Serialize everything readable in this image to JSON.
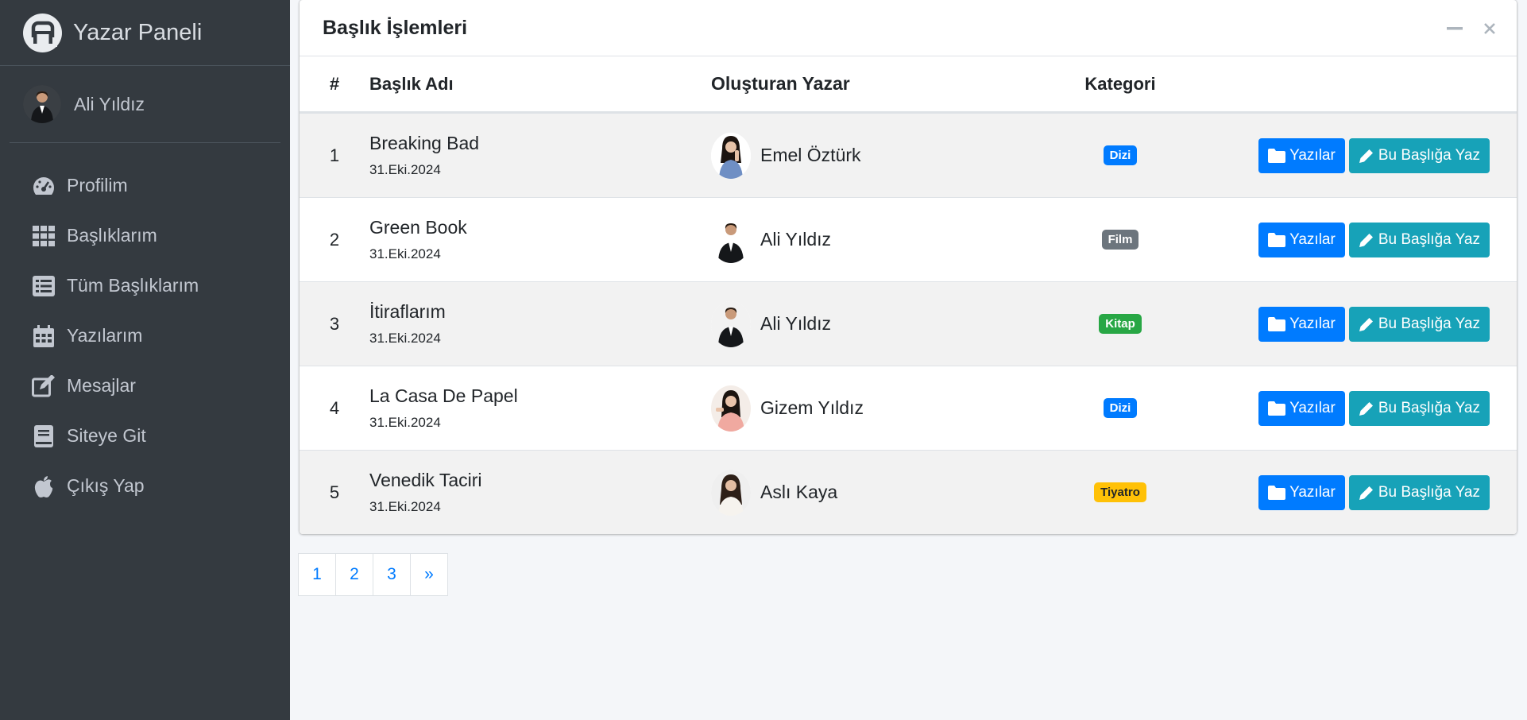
{
  "brand": {
    "title": "Yazar Paneli"
  },
  "user": {
    "name": "Ali Yıldız"
  },
  "sidebar": {
    "items": [
      {
        "label": "Profilim",
        "icon": "dashboard-icon"
      },
      {
        "label": "Başlıklarım",
        "icon": "grid-icon"
      },
      {
        "label": "Tüm Başlıklarım",
        "icon": "list-icon"
      },
      {
        "label": "Yazılarım",
        "icon": "calendar-icon"
      },
      {
        "label": "Mesajlar",
        "icon": "edit-icon"
      },
      {
        "label": "Siteye Git",
        "icon": "book-icon"
      },
      {
        "label": "Çıkış Yap",
        "icon": "apple-icon"
      }
    ]
  },
  "card": {
    "title": "Başlık İşlemleri",
    "columns": {
      "num": "#",
      "title": "Başlık Adı",
      "author": "Oluşturan Yazar",
      "category": "Kategori"
    },
    "rows": [
      {
        "num": "1",
        "title": "Breaking Bad",
        "date": "31.Eki.2024",
        "author": "Emel Öztürk",
        "category": "Dizi",
        "category_color": "#007bff",
        "btn_posts": "Yazılar",
        "btn_write": "Bu Başlığa Yaz"
      },
      {
        "num": "2",
        "title": "Green Book",
        "date": "31.Eki.2024",
        "author": "Ali Yıldız",
        "category": "Film",
        "category_color": "#6c757d",
        "btn_posts": "Yazılar",
        "btn_write": "Bu Başlığa Yaz"
      },
      {
        "num": "3",
        "title": "İtiraflarım",
        "date": "31.Eki.2024",
        "author": "Ali Yıldız",
        "category": "Kitap",
        "category_color": "#28a745",
        "btn_posts": "Yazılar",
        "btn_write": "Bu Başlığa Yaz"
      },
      {
        "num": "4",
        "title": "La Casa De Papel",
        "date": "31.Eki.2024",
        "author": "Gizem Yıldız",
        "category": "Dizi",
        "category_color": "#007bff",
        "btn_posts": "Yazılar",
        "btn_write": "Bu Başlığa Yaz"
      },
      {
        "num": "5",
        "title": "Venedik Taciri",
        "date": "31.Eki.2024",
        "author": "Aslı Kaya",
        "category": "Tiyatro",
        "category_color": "#ffc107",
        "btn_posts": "Yazılar",
        "btn_write": "Bu Başlığa Yaz"
      }
    ]
  },
  "pagination": {
    "pages": [
      "1",
      "2",
      "3",
      "»"
    ]
  },
  "colors": {
    "sidebar": "#343a40",
    "primary": "#007bff",
    "info": "#17a2b8",
    "content_bg": "#f4f6f9"
  }
}
